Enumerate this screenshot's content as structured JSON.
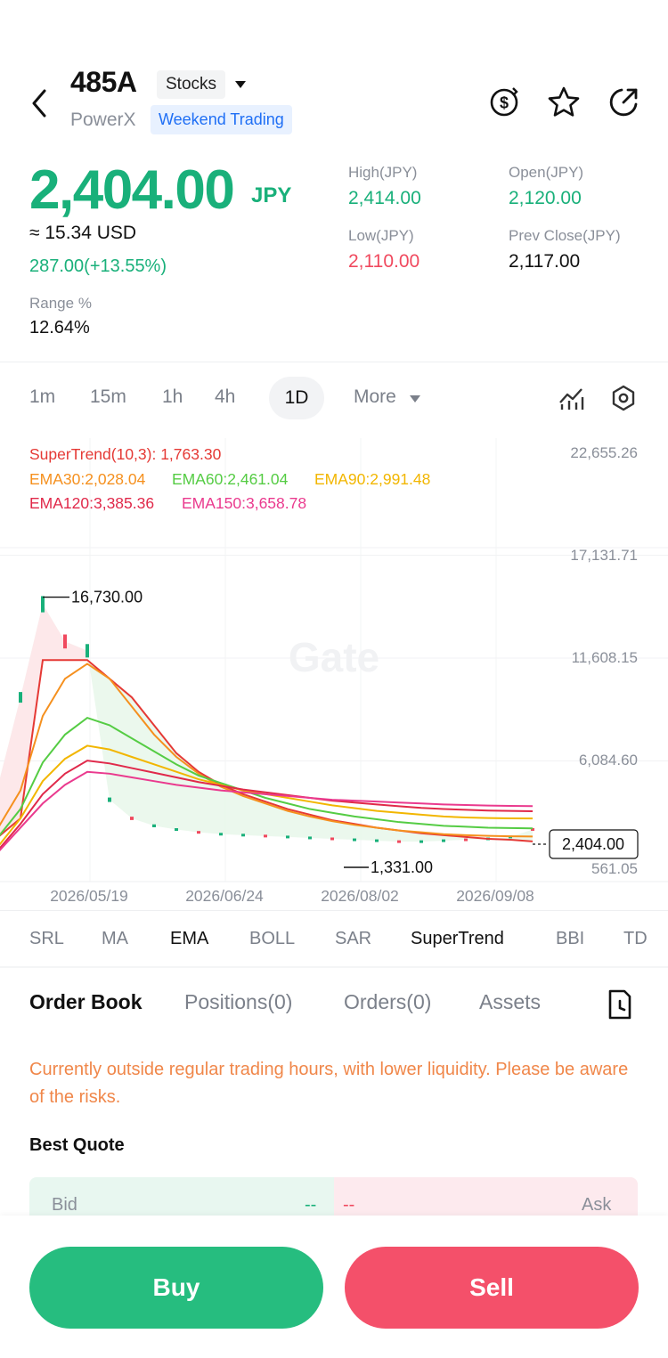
{
  "header": {
    "ticker": "485A",
    "type_label": "Stocks",
    "company": "PowerX",
    "weekend_label": "Weekend Trading"
  },
  "price": {
    "last": "2,404.00",
    "currency": "JPY",
    "usd_approx": "≈ 15.34 USD",
    "change": "287.00(+13.55%)",
    "range_label": "Range %",
    "range_value": "12.64%"
  },
  "stats": {
    "high_label": "High(JPY)",
    "high_value": "2,414.00",
    "open_label": "Open(JPY)",
    "open_value": "2,120.00",
    "low_label": "Low(JPY)",
    "low_value": "2,110.00",
    "prev_label": "Prev Close(JPY)",
    "prev_value": "2,117.00"
  },
  "colors": {
    "up": "#19b07a",
    "down": "#f0495e",
    "accent_blue": "#1f6ff5",
    "warning": "#f0874a"
  },
  "timeframes": {
    "m1": "1m",
    "m15": "15m",
    "h1": "1h",
    "h4": "4h",
    "d1": "1D",
    "more": "More"
  },
  "chart_legend": {
    "supertrend": "SuperTrend(10,3): 1,763.30",
    "ema30": "EMA30:2,028.04",
    "ema60": "EMA60:2,461.04",
    "ema90": "EMA90:2,991.48",
    "ema120": "EMA120:3,385.36",
    "ema150": "EMA150:3,658.78"
  },
  "chart_data": {
    "type": "line",
    "y_ticks": [
      "22,655.26",
      "17,131.71",
      "11,608.15",
      "6,084.60",
      "561.05"
    ],
    "x_ticks": [
      "2026/05/19",
      "2026/06/24",
      "2026/08/02",
      "2026/09/08"
    ],
    "annotations": {
      "max": "16,730.00",
      "min": "1,331.00",
      "last": "2,404.00"
    },
    "watermark": "Gate",
    "ylim": [
      561.05,
      22655.26
    ],
    "indices": [
      0,
      6,
      12,
      18,
      24,
      30,
      36,
      42,
      48,
      54,
      60,
      66,
      72,
      78,
      84,
      90,
      96,
      102,
      108,
      114,
      120,
      126,
      132,
      138,
      144
    ],
    "close": [
      4800,
      9500,
      14500,
      12500,
      12000,
      4000,
      3000,
      2600,
      2400,
      2250,
      2150,
      2100,
      2050,
      2000,
      1950,
      1900,
      1850,
      1800,
      1750,
      1750,
      1800,
      1850,
      1900,
      2000,
      2404
    ],
    "series": [
      {
        "name": "SuperTrend(10,3)",
        "color": "#e53935",
        "values": [
          2000,
          3000,
          11500,
          11500,
          11500,
          10500,
          9500,
          8000,
          6500,
          5500,
          4800,
          4300,
          3900,
          3500,
          3200,
          2900,
          2700,
          2500,
          2350,
          2200,
          2100,
          2000,
          1900,
          1850,
          1763.3
        ]
      },
      {
        "name": "EMA30",
        "color": "#f5901e",
        "values": [
          2500,
          4500,
          8500,
          10500,
          11300,
          10500,
          9000,
          7500,
          6300,
          5400,
          4700,
          4200,
          3800,
          3400,
          3100,
          2850,
          2650,
          2500,
          2350,
          2250,
          2150,
          2100,
          2060,
          2040,
          2028.04
        ]
      },
      {
        "name": "EMA60",
        "color": "#55cc44",
        "values": [
          2000,
          3500,
          6000,
          7500,
          8400,
          8000,
          7300,
          6600,
          5900,
          5300,
          4900,
          4500,
          4100,
          3800,
          3500,
          3300,
          3100,
          2950,
          2800,
          2700,
          2600,
          2550,
          2500,
          2480,
          2461.04
        ]
      },
      {
        "name": "EMA90",
        "color": "#f2b600",
        "values": [
          1500,
          3000,
          5000,
          6200,
          6900,
          6700,
          6300,
          5900,
          5500,
          5100,
          4800,
          4500,
          4300,
          4100,
          3900,
          3700,
          3550,
          3400,
          3300,
          3200,
          3100,
          3050,
          3020,
          3000,
          2991.48
        ]
      },
      {
        "name": "EMA120",
        "color": "#e0294a",
        "values": [
          1300,
          2700,
          4300,
          5400,
          6100,
          5950,
          5700,
          5450,
          5200,
          4950,
          4750,
          4550,
          4400,
          4250,
          4100,
          3950,
          3850,
          3750,
          3650,
          3560,
          3500,
          3460,
          3420,
          3400,
          3385.36
        ]
      },
      {
        "name": "EMA150",
        "color": "#ea3a8e",
        "values": [
          1200,
          2500,
          3800,
          4800,
          5500,
          5400,
          5200,
          5000,
          4800,
          4650,
          4500,
          4400,
          4300,
          4200,
          4100,
          4000,
          3950,
          3900,
          3850,
          3800,
          3750,
          3720,
          3690,
          3670,
          3658.78
        ]
      }
    ]
  },
  "indicators": [
    "SRL",
    "MA",
    "EMA",
    "BOLL",
    "SAR",
    "SuperTrend",
    "BBI",
    "TD"
  ],
  "bottom_tabs": {
    "order_book": "Order Book",
    "positions": "Positions(0)",
    "orders": "Orders(0)",
    "assets": "Assets"
  },
  "warning": "Currently outside regular trading hours, with lower liquidity. Please be aware of the risks.",
  "best_quote": {
    "title": "Best Quote",
    "bid_label": "Bid",
    "bid_value": "--",
    "ask_value": "--",
    "ask_label": "Ask"
  },
  "actions": {
    "buy": "Buy",
    "sell": "Sell"
  }
}
